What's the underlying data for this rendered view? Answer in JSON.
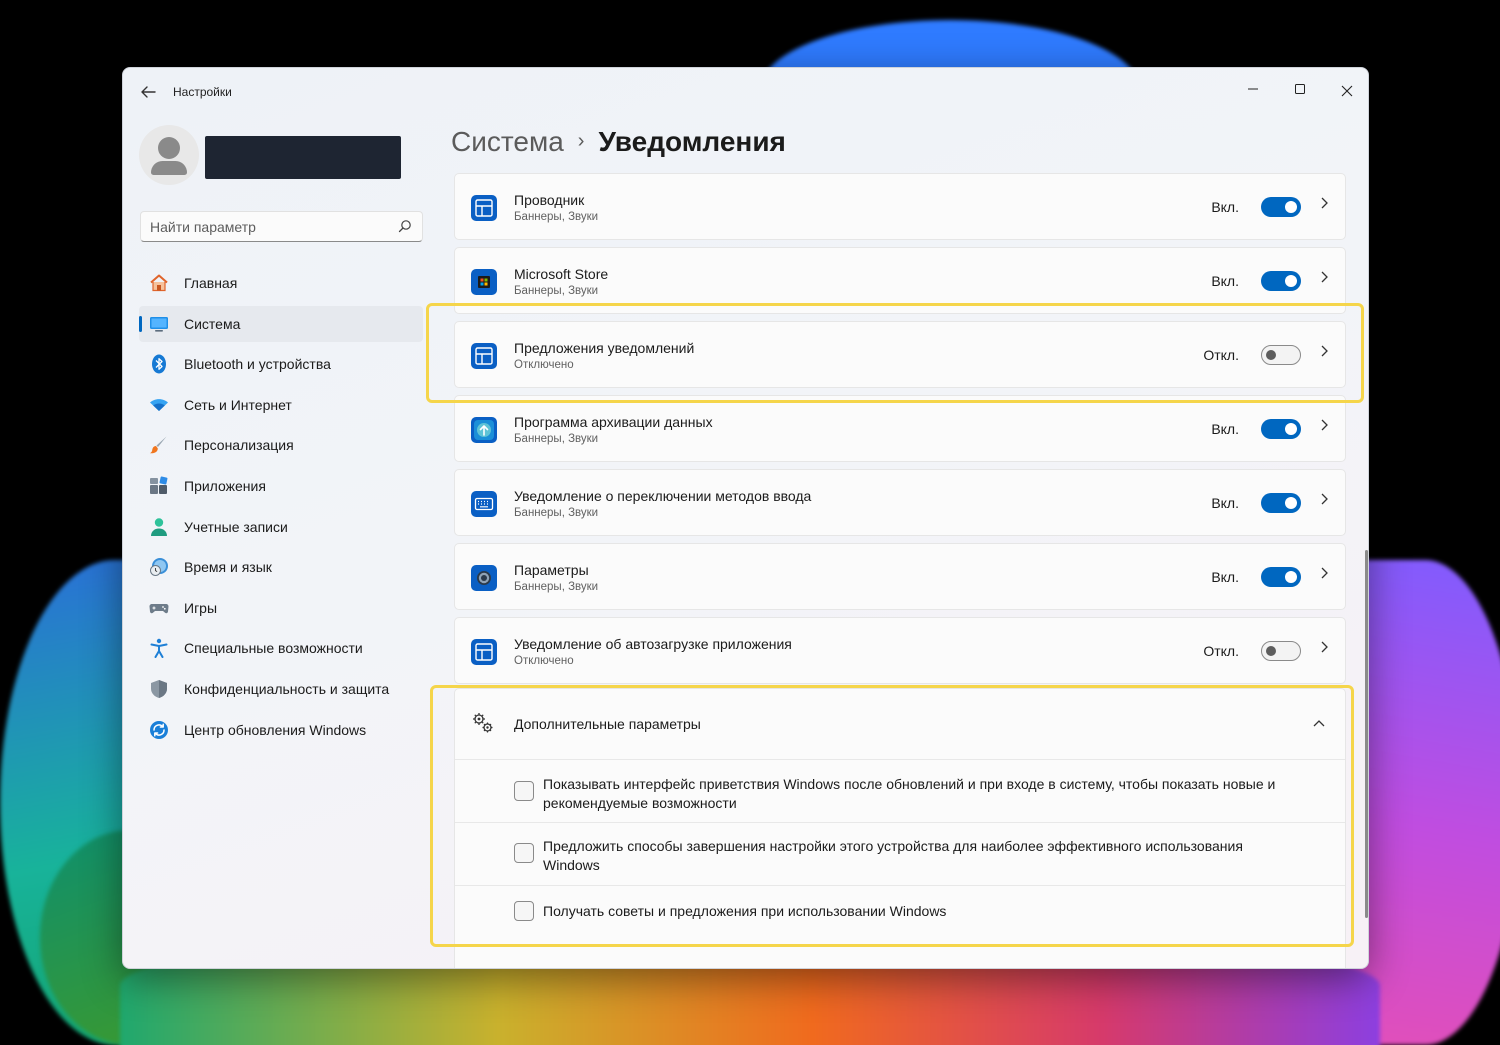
{
  "window": {
    "title": "Настройки",
    "back_icon": "arrow-left-icon",
    "minimize_icon": "minimize-icon",
    "maximize_icon": "maximize-icon",
    "close_icon": "close-icon"
  },
  "search": {
    "placeholder": "Найти параметр",
    "icon": "search-icon"
  },
  "sidebar": {
    "items": [
      {
        "label": "Главная",
        "icon": "home-icon",
        "active": false
      },
      {
        "label": "Система",
        "icon": "system-monitor-icon",
        "active": true
      },
      {
        "label": "Bluetooth и устройства",
        "icon": "bluetooth-icon",
        "active": false
      },
      {
        "label": "Сеть и Интернет",
        "icon": "wifi-icon",
        "active": false
      },
      {
        "label": "Персонализация",
        "icon": "brush-icon",
        "active": false
      },
      {
        "label": "Приложения",
        "icon": "apps-icon",
        "active": false
      },
      {
        "label": "Учетные записи",
        "icon": "account-icon",
        "active": false
      },
      {
        "label": "Время и язык",
        "icon": "time-language-icon",
        "active": false
      },
      {
        "label": "Игры",
        "icon": "gamepad-icon",
        "active": false
      },
      {
        "label": "Специальные возможности",
        "icon": "accessibility-icon",
        "active": false
      },
      {
        "label": "Конфиденциальность и защита",
        "icon": "shield-icon",
        "active": false
      },
      {
        "label": "Центр обновления Windows",
        "icon": "windows-update-icon",
        "active": false
      }
    ]
  },
  "breadcrumb": {
    "parent": "Система",
    "separator": "›",
    "current": "Уведомления"
  },
  "apps": [
    {
      "title": "Проводник",
      "subtitle": "Баннеры, Звуки",
      "state": "Вкл.",
      "on": true,
      "icon": "explorer-icon"
    },
    {
      "title": "Microsoft Store",
      "subtitle": "Баннеры, Звуки",
      "state": "Вкл.",
      "on": true,
      "icon": "store-icon"
    },
    {
      "title": "Предложения уведомлений",
      "subtitle": "Отключено",
      "state": "Откл.",
      "on": false,
      "icon": "app-window-icon"
    },
    {
      "title": "Программа архивации данных",
      "subtitle": "Баннеры, Звуки",
      "state": "Вкл.",
      "on": true,
      "icon": "backup-icon"
    },
    {
      "title": "Уведомление о переключении методов ввода",
      "subtitle": "Баннеры, Звуки",
      "state": "Вкл.",
      "on": true,
      "icon": "keyboard-icon"
    },
    {
      "title": "Параметры",
      "subtitle": "Баннеры, Звуки",
      "state": "Вкл.",
      "on": true,
      "icon": "settings-gear-icon"
    },
    {
      "title": "Уведомление об автозагрузке приложения",
      "subtitle": "Отключено",
      "state": "Откл.",
      "on": false,
      "icon": "app-window-icon"
    }
  ],
  "advanced": {
    "title": "Дополнительные параметры",
    "icon": "gears-icon",
    "expanded": true,
    "options": [
      {
        "label": "Показывать интерфейс приветствия Windows после обновлений и при входе в систему, чтобы показать новые и рекомендуемые возможности",
        "checked": false
      },
      {
        "label": "Предложить способы завершения настройки этого устройства для наиболее эффективного использования Windows",
        "checked": false
      },
      {
        "label": "Получать советы и предложения при использовании Windows",
        "checked": false
      }
    ]
  },
  "colors": {
    "accent": "#0067c0",
    "highlight": "#f5d54a"
  }
}
